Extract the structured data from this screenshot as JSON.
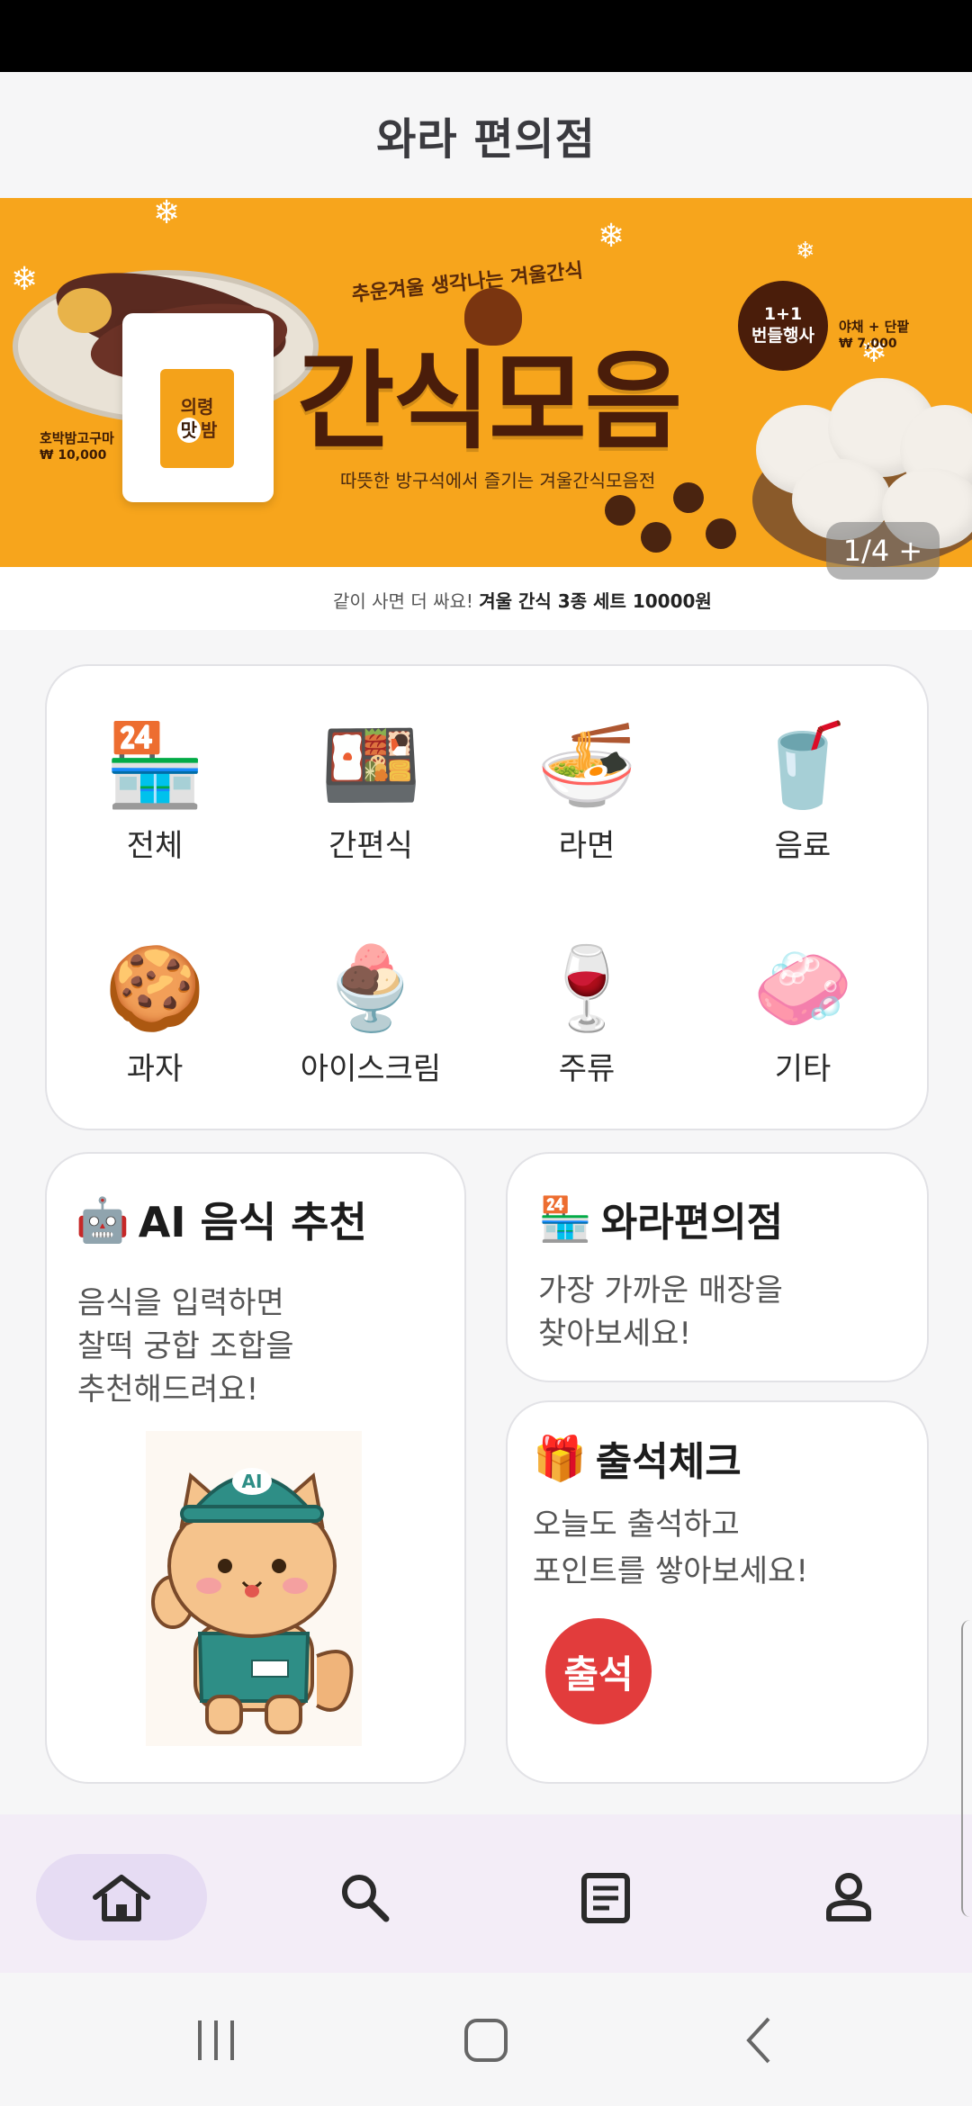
{
  "app": {
    "title": "와라 편의점"
  },
  "banner": {
    "tagline": "추운겨울 생각나는 겨울간식",
    "headline": "간식모음",
    "subline": "따뜻한 방구석에서 즐기는 겨울간식모음전",
    "bottom_text_plain": "같이 사면 더 싸요!",
    "bottom_text_bold": "겨울 간식 3종 세트 10000원",
    "pouch_label_top": "의령",
    "pouch_label_bottom_a": "맛",
    "pouch_label_bottom_b": "밤",
    "potato_name": "호박밤고구마",
    "potato_price": "₩ 10,000",
    "badge_line1": "1+1",
    "badge_line2": "번들행사",
    "bun_name": "야채 + 단팥",
    "bun_price": "₩ 7,000",
    "counter": "1/4 +"
  },
  "categories": [
    {
      "label": "전체",
      "icon": "🏪"
    },
    {
      "label": "간편식",
      "icon": "🍱"
    },
    {
      "label": "라면",
      "icon": "🍜"
    },
    {
      "label": "음료",
      "icon": "🥤"
    },
    {
      "label": "과자",
      "icon": "🍪"
    },
    {
      "label": "아이스크림",
      "icon": "🍨"
    },
    {
      "label": "주류",
      "icon": "🍷"
    },
    {
      "label": "기타",
      "icon": "🧼"
    }
  ],
  "ai_card": {
    "icon": "🤖",
    "title": "AI 음식 추천",
    "desc": "음식을 입력하면\n찰떡 궁합 조합을\n추천해드려요!",
    "mascot_cap_text": "AI"
  },
  "store_card": {
    "icon": "🏪",
    "title": "와라편의점",
    "desc": "가장 가까운 매장을\n찾아보세요!"
  },
  "attend_card": {
    "icon": "🎁",
    "title": "출석체크",
    "desc": "오늘도 출석하고\n포인트를 쌓아보세요!",
    "button": "출석"
  },
  "bottom_nav": [
    {
      "name": "home-icon",
      "active": true
    },
    {
      "name": "search-icon",
      "active": false
    },
    {
      "name": "list-icon",
      "active": false
    },
    {
      "name": "profile-icon",
      "active": false
    }
  ],
  "colors": {
    "banner_bg": "#f7a51c",
    "attend_button": "#e23c3c",
    "nav_bg": "#f3edf7",
    "nav_active": "#e6dcf3"
  }
}
